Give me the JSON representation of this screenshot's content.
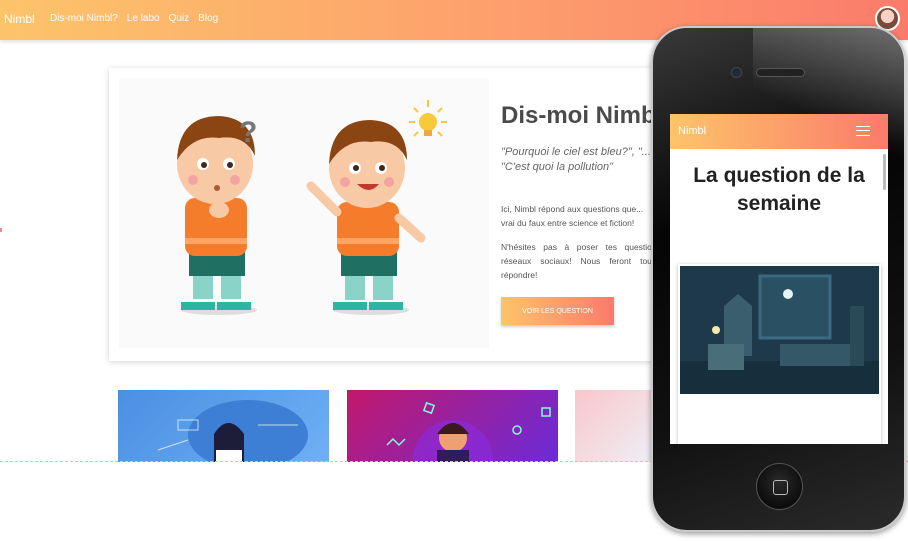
{
  "navbar": {
    "brand": "Nimbl",
    "links": [
      "Dis-moi Nimbl?",
      "Le labo",
      "Quiz",
      "Blog"
    ]
  },
  "hero": {
    "title": "Dis-moi Nimbl",
    "quote": "\"Pourquoi le ciel est bleu?\", \"... \"C'est quoi la pollution\"",
    "paragraph1": "Ici, Nimbl répond aux questions que... vrai du faux entre science et fiction!",
    "paragraph2": "N'hésites pas à poser tes questio... réseaux sociaux! Nous feront tou... répondre!",
    "button": "VOIR LES QUESTION"
  },
  "phone": {
    "brand": "Nimbl",
    "title": "La question de la semaine"
  },
  "colors": {
    "gradient_start": "#fcc46a",
    "gradient_end": "#fb7b6b"
  }
}
